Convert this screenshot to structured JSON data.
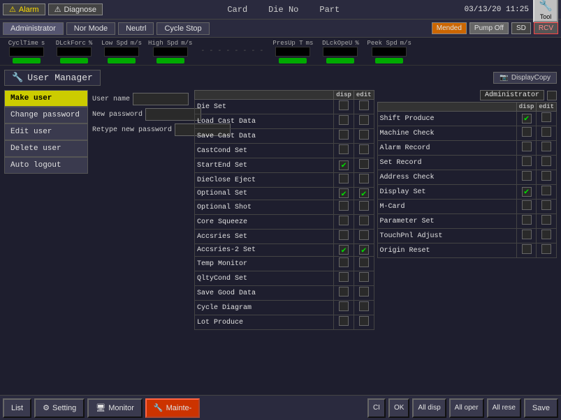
{
  "header": {
    "alarm_label": "Alarm",
    "diagnose_label": "Diagnose",
    "card_label": "Card",
    "die_no_label": "Die No",
    "part_label": "Part",
    "datetime": "03/13/20  11:25",
    "tool_label": "Tool"
  },
  "nav": {
    "admin_label": "Administrator",
    "nor_mode_label": "Nor Mode",
    "neutrl_label": "Neutrl",
    "cycle_stop_label": "Cycle Stop",
    "mended_label": "Mended",
    "pump_off_label": "Pump Off",
    "sd_label": "SD",
    "rcv_label": "RCV"
  },
  "metrics": [
    {
      "label": "CyclTime",
      "unit": "s"
    },
    {
      "label": "DLckForc",
      "unit": "%"
    },
    {
      "label": "Low Spd",
      "unit": "m/s"
    },
    {
      "label": "High Spd",
      "unit": "m/s"
    },
    {
      "label": "PresUp T",
      "unit": "ms"
    },
    {
      "label": "DLckOpeU",
      "unit": "%"
    },
    {
      "label": "Peek Spd",
      "unit": "m/s"
    }
  ],
  "panel": {
    "title": "User Manager",
    "display_copy_label": "DisplayCopy"
  },
  "sidebar": {
    "items": [
      {
        "label": "Make user",
        "active": true
      },
      {
        "label": "Change password",
        "active": false
      },
      {
        "label": "Edit user",
        "active": false
      },
      {
        "label": "Delete user",
        "active": false
      },
      {
        "label": "Auto logout",
        "active": false
      }
    ]
  },
  "form": {
    "user_name_label": "User name",
    "new_password_label": "New password",
    "retype_label": "Retype new password"
  },
  "admin": {
    "label": "Administrator",
    "disp_header": "disp",
    "edit_header": "edit"
  },
  "perm_table_left": {
    "headers": [
      "",
      "disp",
      "edit"
    ],
    "rows": [
      {
        "name": "Die Set",
        "disp": false,
        "edit": false
      },
      {
        "name": "Load Cast Data",
        "disp": false,
        "edit": false
      },
      {
        "name": "Save Cast Data",
        "disp": false,
        "edit": false
      },
      {
        "name": "CastCond Set",
        "disp": false,
        "edit": false
      },
      {
        "name": "StartEnd Set",
        "disp": true,
        "edit": false
      },
      {
        "name": "DieClose Eject",
        "disp": false,
        "edit": false
      },
      {
        "name": "Optional Set",
        "disp": true,
        "edit": true
      },
      {
        "name": "Optional Shot",
        "disp": false,
        "edit": false
      },
      {
        "name": "Core Squeeze",
        "disp": false,
        "edit": false
      },
      {
        "name": "Accsries Set",
        "disp": false,
        "edit": false
      },
      {
        "name": "Accsries-2 Set",
        "disp": true,
        "edit": true
      },
      {
        "name": "Temp Monitor",
        "disp": false,
        "edit": false
      },
      {
        "name": "QltyCond Set",
        "disp": false,
        "edit": false
      },
      {
        "name": "Save Good Data",
        "disp": false,
        "edit": false
      },
      {
        "name": "Cycle Diagram",
        "disp": false,
        "edit": false
      },
      {
        "name": "Lot Produce",
        "disp": false,
        "edit": false
      }
    ]
  },
  "perm_table_right": {
    "headers": [
      "",
      "disp",
      "edit"
    ],
    "rows": [
      {
        "name": "Shift Produce",
        "disp": true,
        "edit": false
      },
      {
        "name": "Machine Check",
        "disp": false,
        "edit": false
      },
      {
        "name": "Alarm Record",
        "disp": false,
        "edit": false
      },
      {
        "name": "Set Record",
        "disp": false,
        "edit": false
      },
      {
        "name": "Address Check",
        "disp": false,
        "edit": false
      },
      {
        "name": "Display Set",
        "disp": true,
        "edit": false
      },
      {
        "name": "M-Card",
        "disp": false,
        "edit": false
      },
      {
        "name": "Parameter Set",
        "disp": false,
        "edit": false
      },
      {
        "name": "TouchPnl Adjust",
        "disp": false,
        "edit": false
      },
      {
        "name": "Origin Reset",
        "disp": false,
        "edit": false
      }
    ]
  },
  "bottom": {
    "list_label": "List",
    "setting_label": "Setting",
    "monitor_label": "Monitor",
    "mainte_label": "Mainte-",
    "ci_label": "CI",
    "ok_label": "OK",
    "all_disp_label": "All disp",
    "all_oper_label": "All oper",
    "all_rese_label": "All rese",
    "save_label": "Save"
  }
}
